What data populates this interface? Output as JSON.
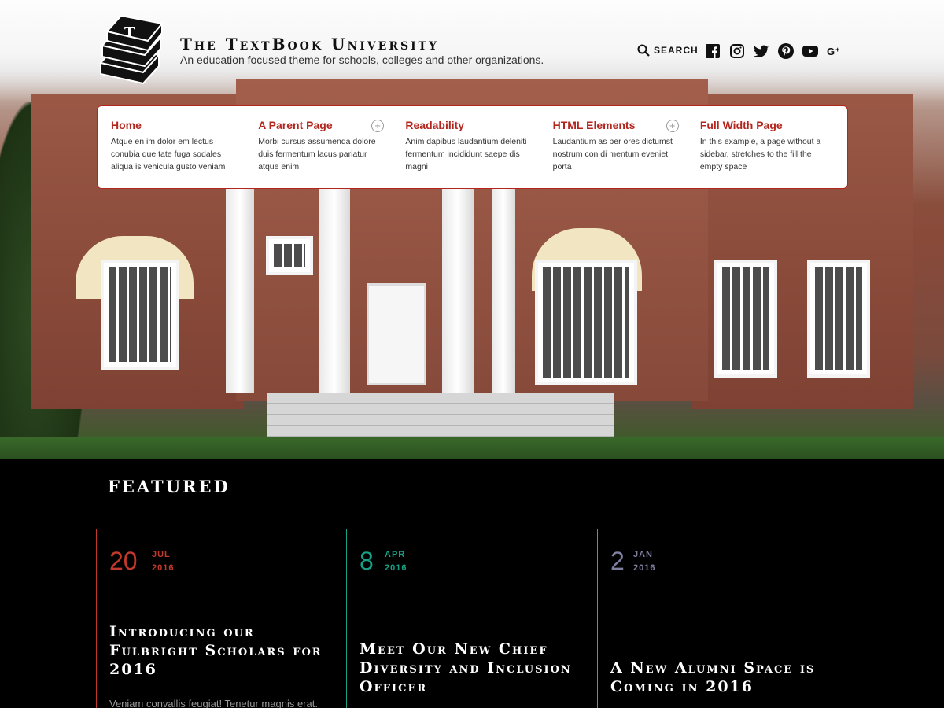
{
  "header": {
    "title": "The TextBook University",
    "tagline": "An education focused theme for schools, colleges and other organizations.",
    "search_label": "SEARCH"
  },
  "social": [
    "facebook-icon",
    "instagram-icon",
    "twitter-icon",
    "pinterest-icon",
    "youtube-icon",
    "google-plus-icon"
  ],
  "menu": {
    "items": [
      {
        "label": "Home",
        "desc": "Atque en im dolor em lectus conubia que tate fuga sodales aliqua is vehicula gusto veniam",
        "submenu": false
      },
      {
        "label": "A Parent Page",
        "desc": "Morbi cursus assumenda dolore duis fermentum lacus pariatur atque enim",
        "submenu": true
      },
      {
        "label": "Readability",
        "desc": "Anim dapibus laudantium deleniti fermentum incididunt saepe dis magni",
        "submenu": false
      },
      {
        "label": "HTML Elements",
        "desc": "Laudantium as per ores dictumst nostrum con di mentum eveniet porta",
        "submenu": true
      },
      {
        "label": "Full Width Page",
        "desc": "In this example, a page without a sidebar, stretches to the fill the empty space",
        "submenu": false
      }
    ]
  },
  "featured": {
    "title": "FEATURED",
    "cards": [
      {
        "day": "20",
        "month": "JUL",
        "year": "2016",
        "color": "#c0392b",
        "headline": "Introducing our Fulbright Scholars for 2016",
        "excerpt": "Veniam convallis feugiat! Tenetur magnis erat."
      },
      {
        "day": "8",
        "month": "APR",
        "year": "2016",
        "color": "#16a085",
        "headline": "Meet Our New Chief Diversity and Inclusion Officer",
        "excerpt": ""
      },
      {
        "day": "2",
        "month": "JAN",
        "year": "2016",
        "color": "#7f7fa0",
        "headline": "A New Alumni Space is Coming in 2016",
        "excerpt": ""
      }
    ]
  },
  "colors": {
    "accent": "#b3261e",
    "background": "#000000"
  }
}
